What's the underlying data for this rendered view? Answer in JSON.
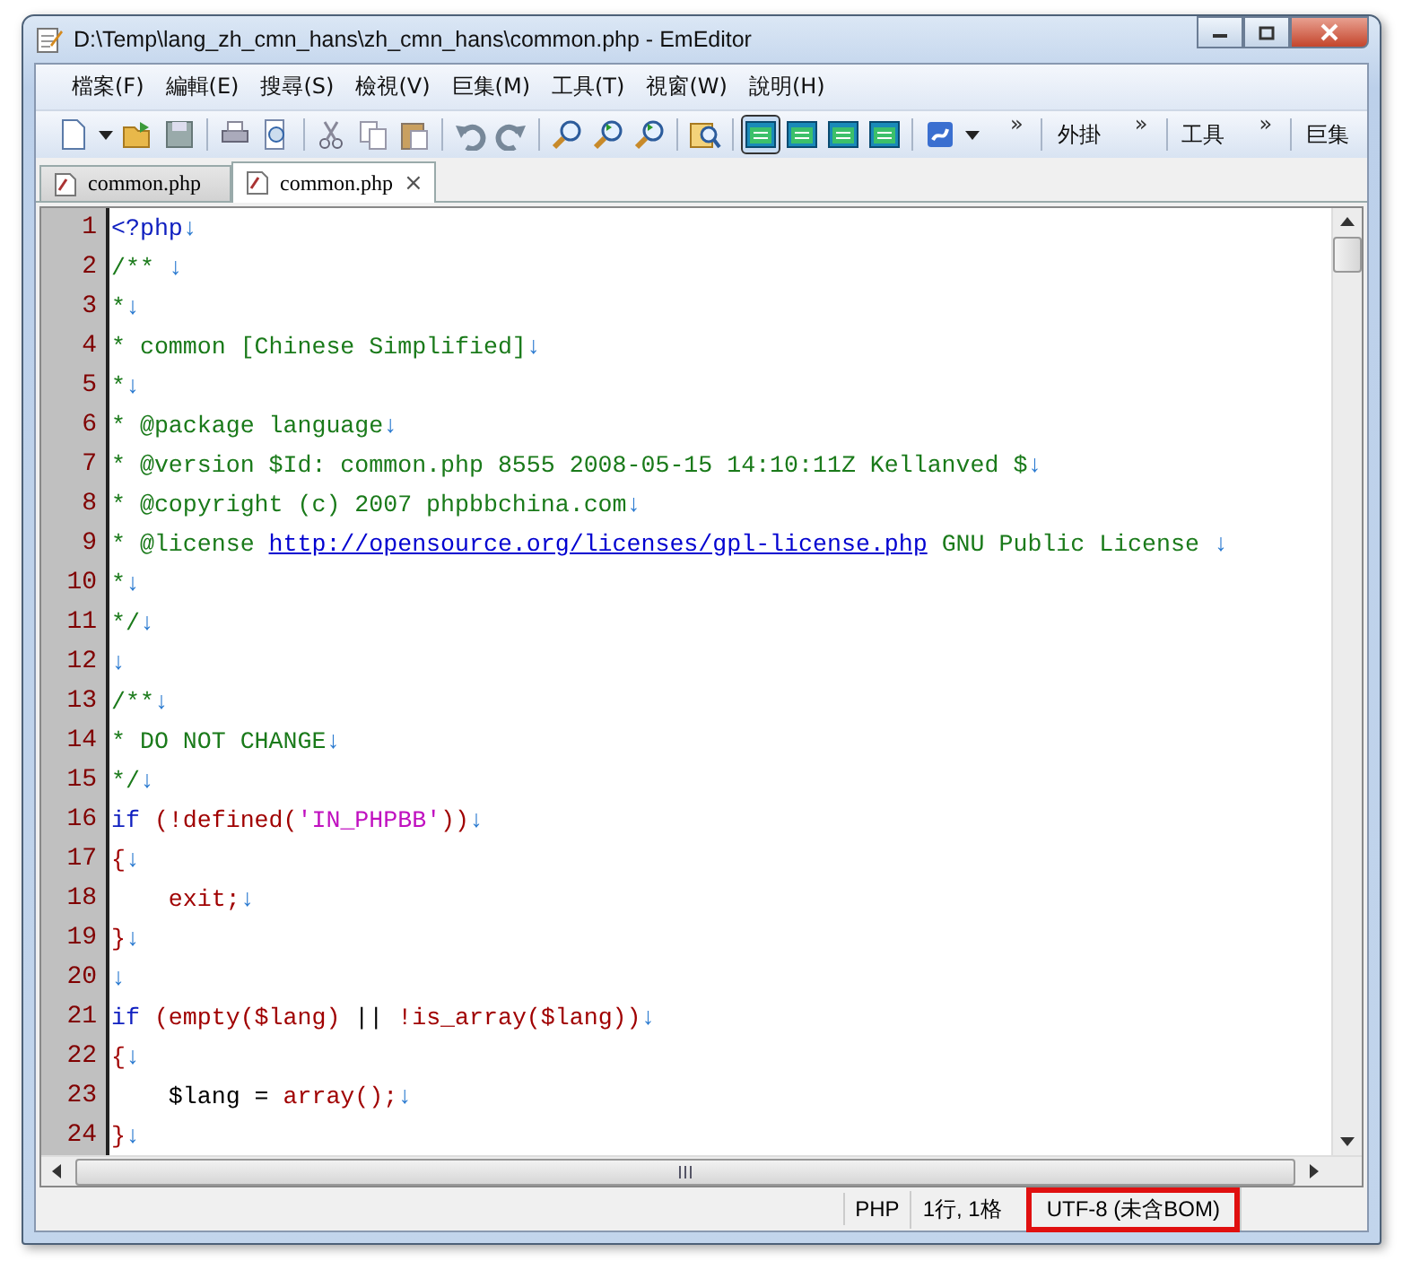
{
  "window": {
    "title": "D:\\Temp\\lang_zh_cmn_hans\\zh_cmn_hans\\common.php - EmEditor"
  },
  "menu": [
    "檔案(F)",
    "編輯(E)",
    "搜尋(S)",
    "檢視(V)",
    "巨集(M)",
    "工具(T)",
    "視窗(W)",
    "說明(H)"
  ],
  "toolbar": {
    "buttons": [
      {
        "pressed": false
      },
      {
        "pressed": false
      },
      {
        "pressed": false
      },
      {
        "pressed": false
      },
      {
        "pressed": false
      },
      {
        "pressed": false
      },
      {
        "pressed": false
      },
      {
        "pressed": false
      },
      {
        "pressed": false
      },
      {
        "pressed": false
      },
      {
        "pressed": false
      },
      {
        "pressed": false
      },
      {
        "pressed": false
      },
      {
        "pressed": false
      },
      {
        "pressed": true
      },
      {
        "pressed": false
      },
      {
        "pressed": false
      },
      {
        "pressed": false
      },
      {
        "pressed": false
      }
    ],
    "sections": [
      {
        "chevron": "»",
        "label": "外掛"
      },
      {
        "chevron": "»",
        "label": "工具"
      },
      {
        "chevron": "»",
        "label": "巨集"
      }
    ]
  },
  "tabs": [
    {
      "label": "common.php",
      "selected": false
    },
    {
      "label": "common.php",
      "selected": true,
      "close": "×"
    }
  ],
  "lines": [
    {
      "number": "1",
      "tokens": [
        {
          "kind": "keyword",
          "text": "<?php"
        },
        {
          "kind": "eol",
          "text": "↓"
        }
      ]
    },
    {
      "number": "2",
      "tokens": [
        {
          "kind": "comment",
          "text": "/** "
        },
        {
          "kind": "eol",
          "text": "↓"
        }
      ]
    },
    {
      "number": "3",
      "tokens": [
        {
          "kind": "comment",
          "text": "*"
        },
        {
          "kind": "eol",
          "text": "↓"
        }
      ]
    },
    {
      "number": "4",
      "tokens": [
        {
          "kind": "comment",
          "text": "* common [Chinese Simplified]"
        },
        {
          "kind": "eol",
          "text": "↓"
        }
      ]
    },
    {
      "number": "5",
      "tokens": [
        {
          "kind": "comment",
          "text": "*"
        },
        {
          "kind": "eol",
          "text": "↓"
        }
      ]
    },
    {
      "number": "6",
      "tokens": [
        {
          "kind": "comment",
          "text": "* @package language"
        },
        {
          "kind": "eol",
          "text": "↓"
        }
      ]
    },
    {
      "number": "7",
      "tokens": [
        {
          "kind": "comment",
          "text": "* @version $Id: common.php 8555 2008-05-15 14:10:11Z Kellanved $"
        },
        {
          "kind": "eol",
          "text": "↓"
        }
      ]
    },
    {
      "number": "8",
      "tokens": [
        {
          "kind": "comment",
          "text": "* @copyright (c) 2007 phpbbchina.com"
        },
        {
          "kind": "eol",
          "text": "↓"
        }
      ]
    },
    {
      "number": "9",
      "tokens": [
        {
          "kind": "comment",
          "text": "* @license "
        },
        {
          "kind": "link",
          "text": "http://opensource.org/licenses/gpl-license.php"
        },
        {
          "kind": "comment",
          "text": " GNU Public License "
        },
        {
          "kind": "eol",
          "text": "↓"
        }
      ]
    },
    {
      "number": "10",
      "tokens": [
        {
          "kind": "comment",
          "text": "*"
        },
        {
          "kind": "eol",
          "text": "↓"
        }
      ]
    },
    {
      "number": "11",
      "tokens": [
        {
          "kind": "comment",
          "text": "*/"
        },
        {
          "kind": "eol",
          "text": "↓"
        }
      ]
    },
    {
      "number": "12",
      "tokens": [
        {
          "kind": "eol",
          "text": "↓"
        }
      ]
    },
    {
      "number": "13",
      "tokens": [
        {
          "kind": "comment",
          "text": "/**"
        },
        {
          "kind": "eol",
          "text": "↓"
        }
      ]
    },
    {
      "number": "14",
      "tokens": [
        {
          "kind": "comment",
          "text": "* DO NOT CHANGE"
        },
        {
          "kind": "eol",
          "text": "↓"
        }
      ]
    },
    {
      "number": "15",
      "tokens": [
        {
          "kind": "comment",
          "text": "*/"
        },
        {
          "kind": "eol",
          "text": "↓"
        }
      ]
    },
    {
      "number": "16",
      "tokens": [
        {
          "kind": "keyword",
          "text": "if"
        },
        {
          "kind": "func",
          "text": " (!defined("
        },
        {
          "kind": "string",
          "text": "'IN_PHPBB'"
        },
        {
          "kind": "func",
          "text": "))"
        },
        {
          "kind": "eol",
          "text": "↓"
        }
      ]
    },
    {
      "number": "17",
      "tokens": [
        {
          "kind": "func",
          "text": "{"
        },
        {
          "kind": "eol",
          "text": "↓"
        }
      ]
    },
    {
      "number": "18",
      "tokens": [
        {
          "kind": "func",
          "text": "    exit;"
        },
        {
          "kind": "eol",
          "text": "↓"
        }
      ]
    },
    {
      "number": "19",
      "tokens": [
        {
          "kind": "func",
          "text": "}"
        },
        {
          "kind": "eol",
          "text": "↓"
        }
      ]
    },
    {
      "number": "20",
      "tokens": [
        {
          "kind": "eol",
          "text": "↓"
        }
      ]
    },
    {
      "number": "21",
      "tokens": [
        {
          "kind": "keyword",
          "text": "if"
        },
        {
          "kind": "func",
          "text": " (empty($lang) "
        },
        {
          "kind": "plain",
          "text": "||"
        },
        {
          "kind": "func",
          "text": " !is_array($lang))"
        },
        {
          "kind": "eol",
          "text": "↓"
        }
      ]
    },
    {
      "number": "22",
      "tokens": [
        {
          "kind": "func",
          "text": "{"
        },
        {
          "kind": "eol",
          "text": "↓"
        }
      ]
    },
    {
      "number": "23",
      "tokens": [
        {
          "kind": "plain",
          "text": "    $lang = "
        },
        {
          "kind": "func",
          "text": "array();"
        },
        {
          "kind": "eol",
          "text": "↓"
        }
      ]
    },
    {
      "number": "24",
      "tokens": [
        {
          "kind": "func",
          "text": "}"
        },
        {
          "kind": "eol",
          "text": "↓"
        }
      ]
    }
  ],
  "status_bar": [
    {
      "text": "PHP",
      "highlighted": false
    },
    {
      "text": "1行, 1格",
      "highlighted": false
    },
    {
      "text": "UTF-8 (未含BOM)",
      "highlighted": true
    }
  ]
}
